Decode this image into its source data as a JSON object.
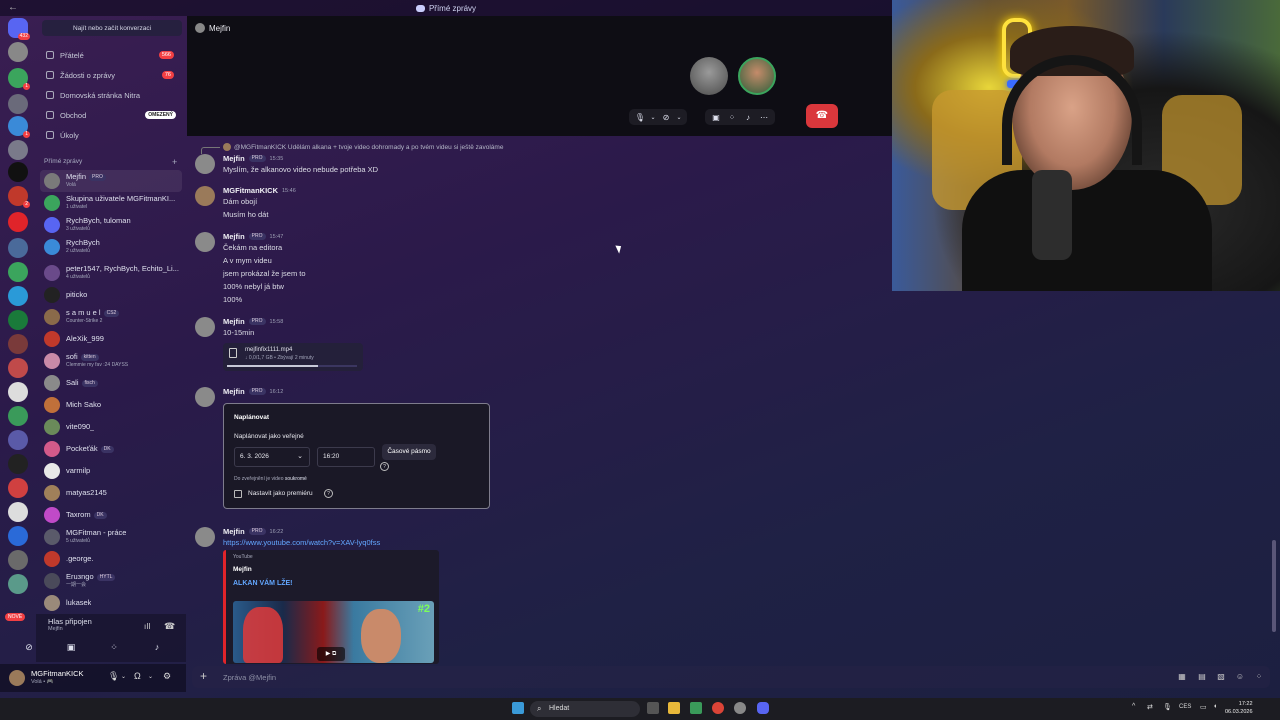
{
  "titlebar": {
    "title": "Přímé zprávy"
  },
  "rail": {
    "new_label": "NOVÉ"
  },
  "dm_sidebar": {
    "search_label": "Najít nebo začít konverzaci",
    "nav": [
      {
        "label": "Přátelé",
        "count": "566"
      },
      {
        "label": "Žádosti o zprávy",
        "count": "76"
      },
      {
        "label": "Domovská stránka Nitra"
      },
      {
        "label": "Obchod",
        "tag": "OMEZENÝ"
      },
      {
        "label": "Úkoly"
      }
    ],
    "dm_header": "Přímé zprávy",
    "dms": [
      {
        "name": "Mejfin",
        "pill": "PRO",
        "sub": "Volá",
        "color": "#7a7a7a"
      },
      {
        "name": "Skupina uživatele MGFitmanKI...",
        "sub": "1 uživatel",
        "color": "#3ba55d"
      },
      {
        "name": "RychBych, tuloman",
        "sub": "3 uživatelů",
        "color": "#5865f2"
      },
      {
        "name": "RychBych",
        "sub": "2 uživatelů",
        "color": "#3a8ad8"
      },
      {
        "name": "peter1547, RychBych, Echito_Li...",
        "sub": "4 uživatelů",
        "color": "#6a4a8a"
      },
      {
        "name": "piticko",
        "sub": "",
        "color": "#222"
      },
      {
        "name": "s a m u e l",
        "pill": "CS2",
        "sub": "Counter-Strike 2",
        "color": "#8a6a4a"
      },
      {
        "name": "AleXik_999",
        "sub": "",
        "color": "#c0392b"
      },
      {
        "name": "sofi",
        "pill": "kitten",
        "sub": "Clemmie my fav :24 DAYSS",
        "color": "#c98aa8"
      },
      {
        "name": "Sali",
        "pill": "fisch",
        "sub": "",
        "color": "#8a8a8a"
      },
      {
        "name": "Mich Sako",
        "sub": "",
        "color": "#c0703a"
      },
      {
        "name": "vite090_",
        "sub": "",
        "color": "#6a8a5a"
      },
      {
        "name": "Pockeťák",
        "pill": "DK",
        "sub": "",
        "color": "#d35a8a"
      },
      {
        "name": "varmilp",
        "sub": "",
        "color": "#e8e8e8"
      },
      {
        "name": "matyas2145",
        "sub": "",
        "color": "#a0805a"
      },
      {
        "name": "Taxrom",
        "pill": "DK",
        "sub": "",
        "color": "#c04ac8"
      },
      {
        "name": "MGFitman - práce",
        "sub": "5 uživatelů",
        "color": "#5a5a6a"
      },
      {
        "name": ".george.",
        "sub": "",
        "color": "#c0392b"
      },
      {
        "name": "Еruзngo",
        "pill": "HYTL",
        "sub": "一期一会",
        "color": "#4a4a5a"
      },
      {
        "name": "lukasek",
        "sub": "",
        "color": "#9a8a7a"
      }
    ]
  },
  "voice_panel": {
    "status": "Hlas připojen",
    "channel": "Mejfin"
  },
  "user_panel": {
    "name": "MGFitmanKICK",
    "status": "Volá • 🎮"
  },
  "call": {
    "channel_name": "Mejfin"
  },
  "messages": {
    "reply_preview": "@MGFitmanKICK Udělám alkana + tvoje video dohromady a po tvém videu si ještě zavoláme",
    "groups": [
      {
        "author": "Mejfin",
        "pill": "PRO",
        "time": "15:35",
        "lines": [
          "Myslím, že alkanovo video nebude potřeba XD"
        ]
      },
      {
        "author": "MGFitmanKICK",
        "time": "15:46",
        "lines": [
          "Dám obojí",
          "Musím ho dát"
        ]
      },
      {
        "author": "Mejfin",
        "pill": "PRO",
        "time": "15:47",
        "lines": [
          "Čekám na editora",
          "A v mym videu",
          "jsem prokázal že jsem to",
          "100% nebyl já btw",
          "100%"
        ]
      },
      {
        "author": "Mejfin",
        "pill": "PRO",
        "time": "15:58",
        "lines": [
          "10-15min"
        ]
      },
      {
        "author": "Mejfin",
        "pill": "PRO",
        "time": "16:12",
        "lines": []
      },
      {
        "author": "Mejfin",
        "pill": "PRO",
        "time": "16:22",
        "lines": [
          "https://www.youtube.com/watch?v=XAV-lyq0fss"
        ]
      }
    ],
    "file": {
      "name": "mejfinfix1111.mp4",
      "status": "↓ 0,0/1,7 GB • Zbývají 2 minuty",
      "progress": 0.7
    },
    "schedule": {
      "title": "Naplánovat",
      "public_label": "Naplánovat jako veřejné",
      "date": "6. 3. 2026",
      "time": "16:20",
      "timezone_label": "Časové pásmo",
      "note_prefix": "Do zveřejnění je video",
      "note_state": "soukromé",
      "premiere_label": "Nastavit jako premiéru"
    },
    "embed": {
      "provider": "YouTube",
      "author": "Mejfin",
      "title": "ALKAN VÁM LŽE!",
      "badge": "#2"
    }
  },
  "composer": {
    "placeholder": "Zpráva @Mejfin"
  },
  "taskbar": {
    "search": "Hledat",
    "lang": "CES",
    "time": "17:22",
    "date": "06.03.2026"
  }
}
